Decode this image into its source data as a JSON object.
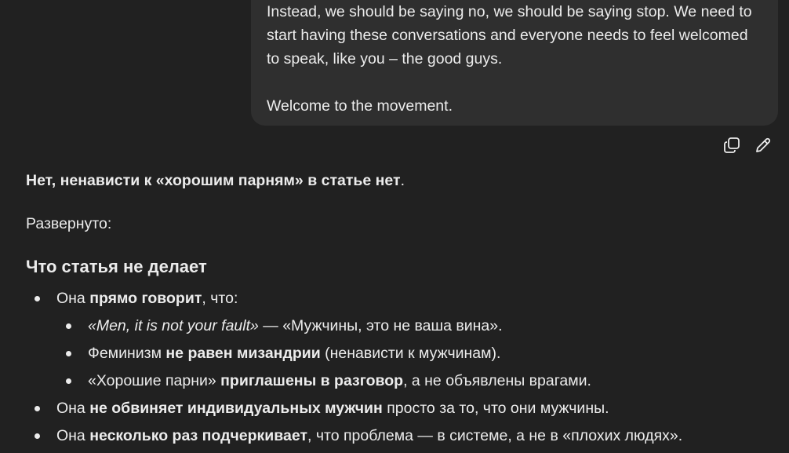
{
  "user_message": {
    "line1": "Instead, we should be saying no, we should be saying stop. We need to",
    "line2": "start having these conversations and everyone needs to feel welcomed",
    "line3": "to speak, like you – the good guys.",
    "line4": "Welcome to the movement."
  },
  "message_actions": {
    "copy_icon": "copy-icon",
    "edit_icon": "pencil-icon"
  },
  "reply": {
    "lead_bold": "Нет, ненависти к «хорошим парням» в статье нет",
    "lead_end": ".",
    "expanded_label": "Развернуто:",
    "section_title": "Что статья не делает",
    "bullets": {
      "b1_pre": "Она ",
      "b1_bold": "прямо говорит",
      "b1_post": ", что:",
      "b1a_italic": "«Men, it is not your fault»",
      "b1a_post": " — «Мужчины, это не ваша вина».",
      "b1b_pre": "Феминизм ",
      "b1b_bold": "не равен мизандрии",
      "b1b_post": " (ненависти к мужчинам).",
      "b1c_pre": "«Хорошие парни» ",
      "b1c_bold": "приглашены в разговор",
      "b1c_post": ", а не объявлены врагами.",
      "b2_pre": "Она ",
      "b2_bold": "не обвиняет индивидуальных мужчин",
      "b2_post": " просто за то, что они мужчины.",
      "b3_pre": "Она ",
      "b3_bold": "несколько раз подчеркивает",
      "b3_post": ", что проблема — в системе, а не в «плохих людях»."
    }
  }
}
